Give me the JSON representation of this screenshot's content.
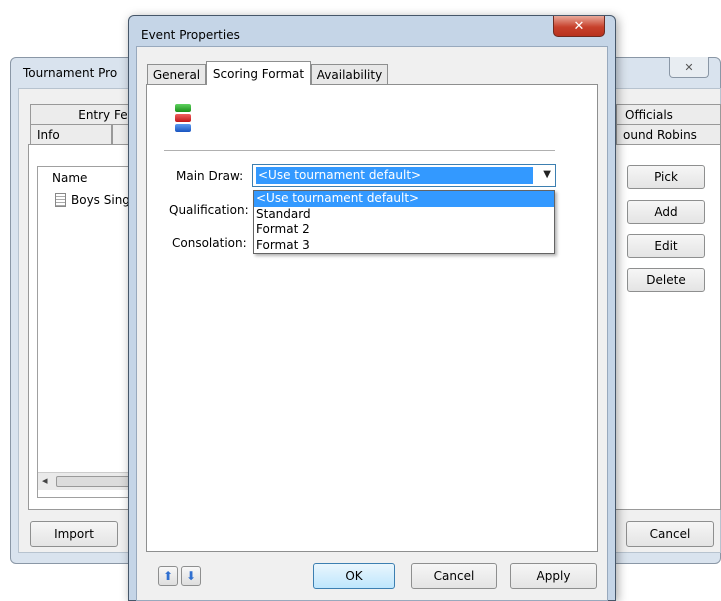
{
  "background_window": {
    "title": "Tournament Pro",
    "close_glyph": "✕",
    "tabs_row1": [
      "Entry Fee",
      "Officials"
    ],
    "tabs_row2": [
      "Info",
      "ound Robins"
    ],
    "list_header": "Name",
    "list_items": [
      "Boys Sing"
    ],
    "scroll_left_glyph": "◂",
    "buttons": {
      "pick": "Pick",
      "add": "Add",
      "edit": "Edit",
      "delete": "Delete",
      "import": "Import",
      "cancel": "Cancel"
    }
  },
  "dialog": {
    "title": "Event Properties",
    "close_glyph": "✕",
    "tabs": [
      "General",
      "Scoring Format",
      "Availability"
    ],
    "active_tab": "Scoring Format",
    "icon": "stacked-color-blocks-icon",
    "fields": {
      "main_draw_label": "Main Draw:",
      "qualification_label": "Qualification:",
      "consolation_label": "Consolation:"
    },
    "combo": {
      "selected": "<Use tournament default>",
      "arrow": "▼",
      "options": [
        "<Use tournament default>",
        "Standard",
        "Format 2",
        "Format 3"
      ]
    },
    "buttons": {
      "up_glyph": "⬆",
      "down_glyph": "⬇",
      "ok": "OK",
      "cancel": "Cancel",
      "apply": "Apply"
    }
  },
  "colors": {
    "selection": "#3399ff",
    "dialog_frame": "#c5d5e7",
    "close_red": "#c7412c"
  }
}
